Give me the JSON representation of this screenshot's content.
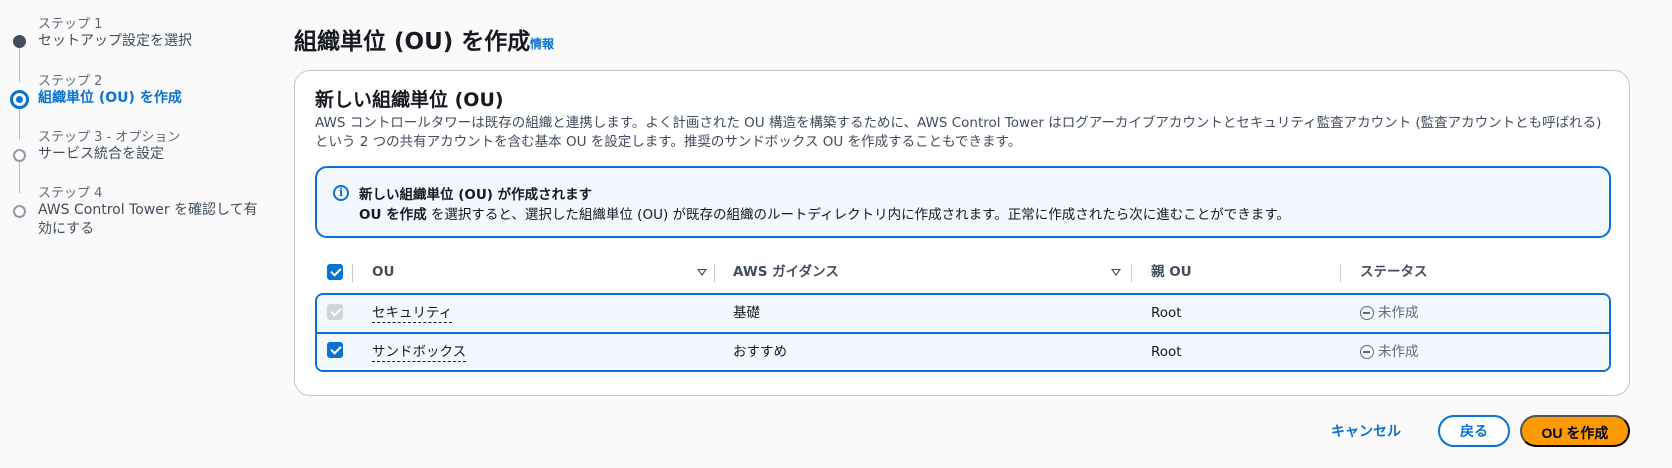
{
  "stepper": {
    "steps": [
      {
        "caption": "ステップ 1",
        "title": "セットアップ設定を選択",
        "state": "done"
      },
      {
        "caption": "ステップ 2",
        "title": "組織単位 (OU) を作成",
        "state": "current"
      },
      {
        "caption": "ステップ 3 - オプション",
        "title": "サービス統合を設定",
        "state": "upcoming"
      },
      {
        "caption": "ステップ 4",
        "title": "AWS Control Tower を確認して有効にする",
        "state": "upcoming"
      }
    ]
  },
  "header": {
    "title": "組織単位 (OU) を作成",
    "info_link": "情報"
  },
  "container": {
    "title": "新しい組織単位 (OU)",
    "description": "AWS コントロールタワーは既存の組織と連携します。よく計画された OU 構造を構築するために、AWS Control Tower はログアーカイブアカウントとセキュリティ監査アカウント (監査アカウントとも呼ばれる) という 2 つの共有アカウントを含む基本 OU を設定します。推奨のサンドボックス OU を作成することもできます。"
  },
  "alert": {
    "title": "新しい組織単位 (OU) が作成されます",
    "body_bold": "OU を作成",
    "body_rest": " を選択すると、選択した組織単位 (OU) が既存の組織のルートディレクトリ内に作成されます。正常に作成されたら次に進むことができます。"
  },
  "table": {
    "headers": {
      "ou": "OU",
      "guidance": "AWS ガイダンス",
      "parent": "親 OU",
      "status": "ステータス"
    },
    "select_all_checked": true,
    "rows": [
      {
        "ou": "セキュリティ",
        "guidance": "基礎",
        "parent": "Root",
        "status": "未作成",
        "checked": true,
        "disabled": true
      },
      {
        "ou": "サンドボックス",
        "guidance": "おすすめ",
        "parent": "Root",
        "status": "未作成",
        "checked": true,
        "disabled": false
      }
    ]
  },
  "footer": {
    "cancel_label": "キャンセル",
    "back_label": "戻る",
    "create_label": "OU を作成"
  },
  "colors": {
    "accent": "#0972d3",
    "primary_button": "#ff9900",
    "row_selected_bg": "#f2f8fd"
  },
  "icons": [
    "info-icon",
    "sort-icon",
    "status-not-created-icon",
    "checkbox-checked-icon"
  ]
}
